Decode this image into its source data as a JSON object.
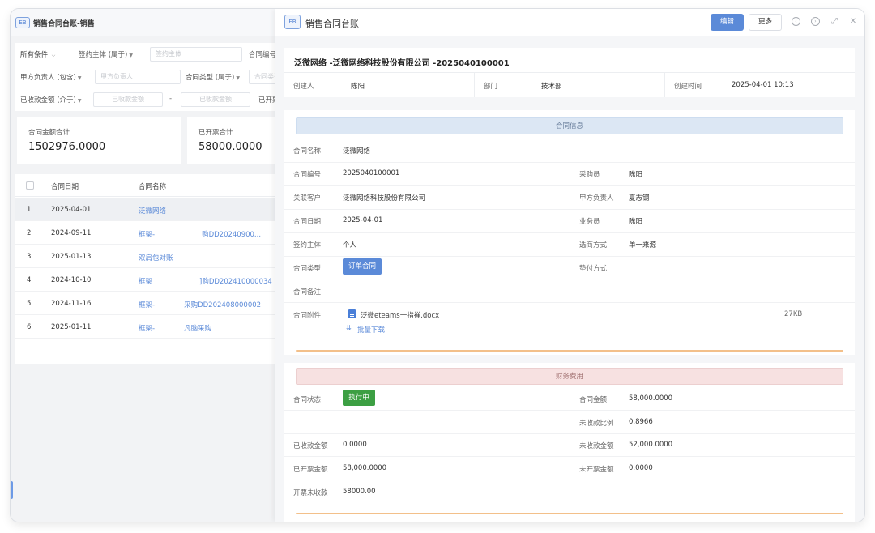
{
  "left": {
    "title": "销售合同台账-销售",
    "logo": "EB",
    "filters": {
      "all_conditions": "所有条件",
      "sign_subject_label": "签约主体 (属于)",
      "sign_subject_placeholder": "签约主体",
      "contract_no_label": "合同编号",
      "party_a_label": "甲方负责人 (包含)",
      "party_a_placeholder": "甲方负责人",
      "contract_type_label": "合同类型 (属于)",
      "contract_type_placeholder": "合同类型",
      "received_label": "已收款金额 (介于)",
      "received_placeholder_from": "已收款金额",
      "range_sep": "-",
      "received_placeholder_to": "已收款金额",
      "invoiced_label": "已开票"
    },
    "summary": [
      {
        "label": "合同金额合计",
        "value": "1502976.0000"
      },
      {
        "label": "已开票合计",
        "value": "58000.0000"
      }
    ],
    "table": {
      "headers": [
        "合同日期",
        "合同名称"
      ],
      "rows": [
        {
          "no": "1",
          "date": "2025-04-01",
          "name": "泛微网络"
        },
        {
          "no": "2",
          "date": "2024-09-11",
          "name": "框架-",
          "name_tail": "购DD20240900..."
        },
        {
          "no": "3",
          "date": "2025-01-13",
          "name": "双肩包对账"
        },
        {
          "no": "4",
          "date": "2024-10-10",
          "name": "框架",
          "name_tail": "]购DD202410000034"
        },
        {
          "no": "5",
          "date": "2024-11-16",
          "name": "框架-",
          "name_tail": "采购DD202408000002"
        },
        {
          "no": "6",
          "date": "2025-01-11",
          "name": "框架-",
          "name_tail": "凡脑采购"
        }
      ]
    }
  },
  "right": {
    "logo": "EB",
    "title": "销售合同台账",
    "edit_label": "编辑",
    "more_label": "更多",
    "record_title": "泛微网络 -泛微网络科技股份有限公司 -2025040100001",
    "meta": {
      "creator_label": "创建人",
      "creator": "陈阳",
      "dept_label": "部门",
      "dept": "技术部",
      "created_label": "创建时间",
      "created": "2025-04-01 10:13"
    },
    "contract_section": "合同信息",
    "fields": {
      "name_label": "合同名称",
      "name": "泛微网络",
      "no_label": "合同编号",
      "no": "2025040100001",
      "buyer_label": "采购员",
      "buyer": "陈阳",
      "customer_label": "关联客户",
      "customer": "泛微网络科技股份有限公司",
      "partya_label": "甲方负责人",
      "partya": "夏志钢",
      "date_label": "合同日期",
      "date": "2025-04-01",
      "sales_label": "业务员",
      "sales": "陈阳",
      "subject_label": "签约主体",
      "subject": "个人",
      "supplier_label": "选商方式",
      "supplier": "单一来源",
      "type_label": "合同类型",
      "type": "订单合同",
      "advance_label": "垫付方式",
      "remark_label": "合同备注",
      "attach_label": "合同附件",
      "attach_name": "泛微eteams一指禅.docx",
      "attach_size": "27KB",
      "batch_download": "批量下载"
    },
    "finance_section": "财务费用",
    "finance": {
      "status_label": "合同状态",
      "status": "执行中",
      "amount_label": "合同金额",
      "amount": "58,000.0000",
      "unpaid_ratio_label": "未收款比例",
      "unpaid_ratio": "0.8966",
      "received_label": "已收款金额",
      "received": "0.0000",
      "unreceived_label": "未收款金额",
      "unreceived": "52,000.0000",
      "invoiced_label": "已开票金额",
      "invoiced": "58,000.0000",
      "uninvoiced_label": "未开票金额",
      "uninvoiced": "0.0000",
      "inv_unrec_label": "开票未收款",
      "inv_unrec": "58000.00"
    }
  }
}
